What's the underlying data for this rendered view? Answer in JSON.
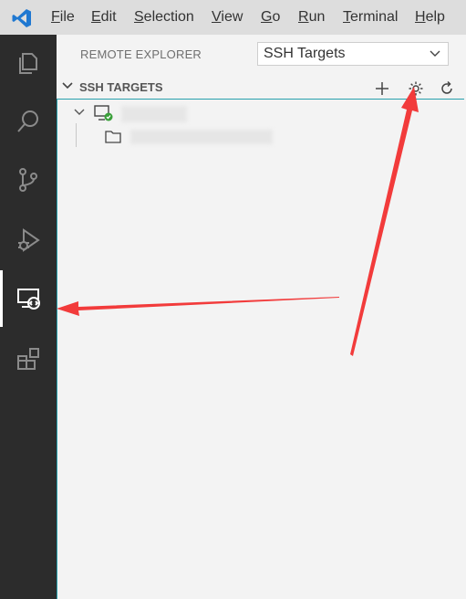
{
  "menu": {
    "items": [
      {
        "label": "File",
        "underline": "F",
        "rest": "ile"
      },
      {
        "label": "Edit",
        "underline": "E",
        "rest": "dit"
      },
      {
        "label": "Selection",
        "underline": "S",
        "rest": "election"
      },
      {
        "label": "View",
        "underline": "V",
        "rest": "iew"
      },
      {
        "label": "Go",
        "underline": "G",
        "rest": "o"
      },
      {
        "label": "Run",
        "underline": "R",
        "rest": "un"
      },
      {
        "label": "Terminal",
        "underline": "T",
        "rest": "erminal"
      },
      {
        "label": "Help",
        "underline": "H",
        "rest": "elp"
      }
    ]
  },
  "sidebar": {
    "view_title": "REMOTE EXPLORER",
    "target_select": {
      "selected": "SSH Targets"
    },
    "section_title": "SSH TARGETS",
    "actions": [
      "add-icon",
      "gear-icon",
      "refresh-icon"
    ]
  },
  "activity_bar": {
    "items": [
      "explorer-icon",
      "search-icon",
      "source-control-icon",
      "run-debug-icon",
      "remote-explorer-icon",
      "extensions-icon"
    ],
    "active": "remote-explorer-icon"
  },
  "colors": {
    "activity_bg": "#2c2c2c",
    "arrow_red": "#f23b3b",
    "status_green": "#3aa03a",
    "focus_border": "#26a0ad"
  }
}
